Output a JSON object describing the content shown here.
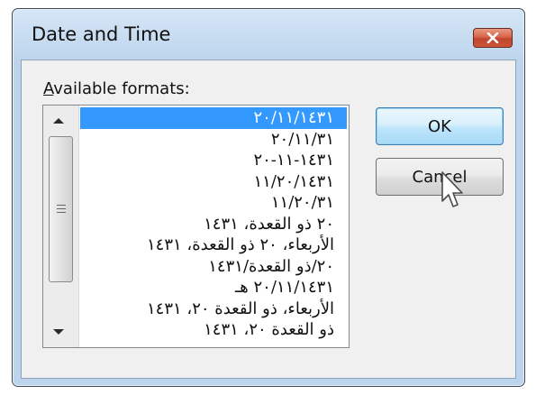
{
  "dialog": {
    "title": "Date and Time",
    "close_icon": "close-x-icon",
    "close_color": "#c7503a"
  },
  "formats_label_accel": "A",
  "formats_label_rest": "vailable formats:",
  "formats": [
    "٢٠/١١/١٤٣١",
    "٢٠/١١/٣١",
    "١٤٣١-١١-٢٠",
    "١١/٢٠/١٤٣١",
    "١١/٢٠/٣١",
    "٢٠ ذو القعدة، ١٤٣١",
    "الأربعاء، ٢٠ ذو القعدة، ١٤٣١",
    "٢٠/ذو القعدة/١٤٣١",
    "٢٠/١١/١٤٣١ هـ",
    "الأربعاء، ذو القعدة ٢٠، ١٤٣١",
    "ذو القعدة ٢٠، ١٤٣١"
  ],
  "selected_index": 0,
  "buttons": {
    "ok": "OK",
    "cancel": "Cancel"
  },
  "colors": {
    "selection": "#3399ff",
    "ok_border": "#3c7fb1"
  },
  "icons": {
    "scroll_up": "arrow-up-icon",
    "scroll_down": "arrow-down-icon",
    "pointer": "mouse-pointer-icon"
  }
}
